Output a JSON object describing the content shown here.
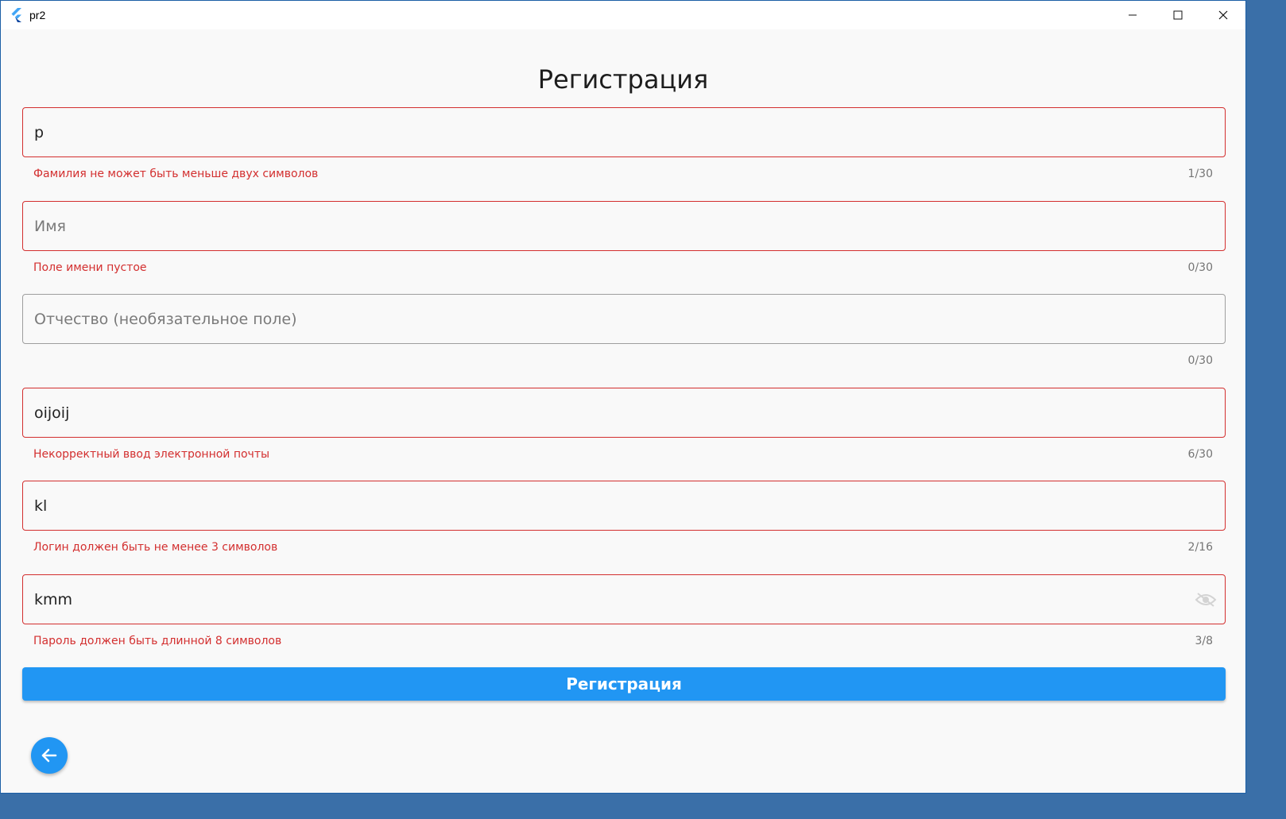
{
  "window": {
    "title": "pr2"
  },
  "page": {
    "title": "Регистрация"
  },
  "fields": [
    {
      "value": "p",
      "placeholder": "",
      "helper": "Фамилия не может быть меньше двух символов",
      "counter": "1/30"
    },
    {
      "value": "",
      "placeholder": "Имя",
      "helper": "Поле имени пустое",
      "counter": "0/30"
    },
    {
      "value": "",
      "placeholder": "Отчество (необязательное поле)",
      "helper": "",
      "counter": "0/30"
    },
    {
      "value": "oijoij",
      "placeholder": "",
      "helper": "Некорректный ввод электронной почты",
      "counter": "6/30"
    },
    {
      "value": "kl",
      "placeholder": "",
      "helper": "Логин должен быть не менее 3 символов",
      "counter": "2/16"
    },
    {
      "value": "kmm",
      "placeholder": "",
      "helper": "Пароль должен быть длинной 8 символов",
      "counter": "3/8"
    }
  ],
  "submit": {
    "label": "Регистрация"
  },
  "colors": {
    "accent": "#2196f3",
    "error": "#d32f2f"
  },
  "icons": {
    "app": "flutter-logo-icon",
    "minimize": "minimize-icon",
    "maximize": "maximize-icon",
    "close": "close-icon",
    "visibility": "visibility-off-icon",
    "back": "arrow-back-icon"
  }
}
